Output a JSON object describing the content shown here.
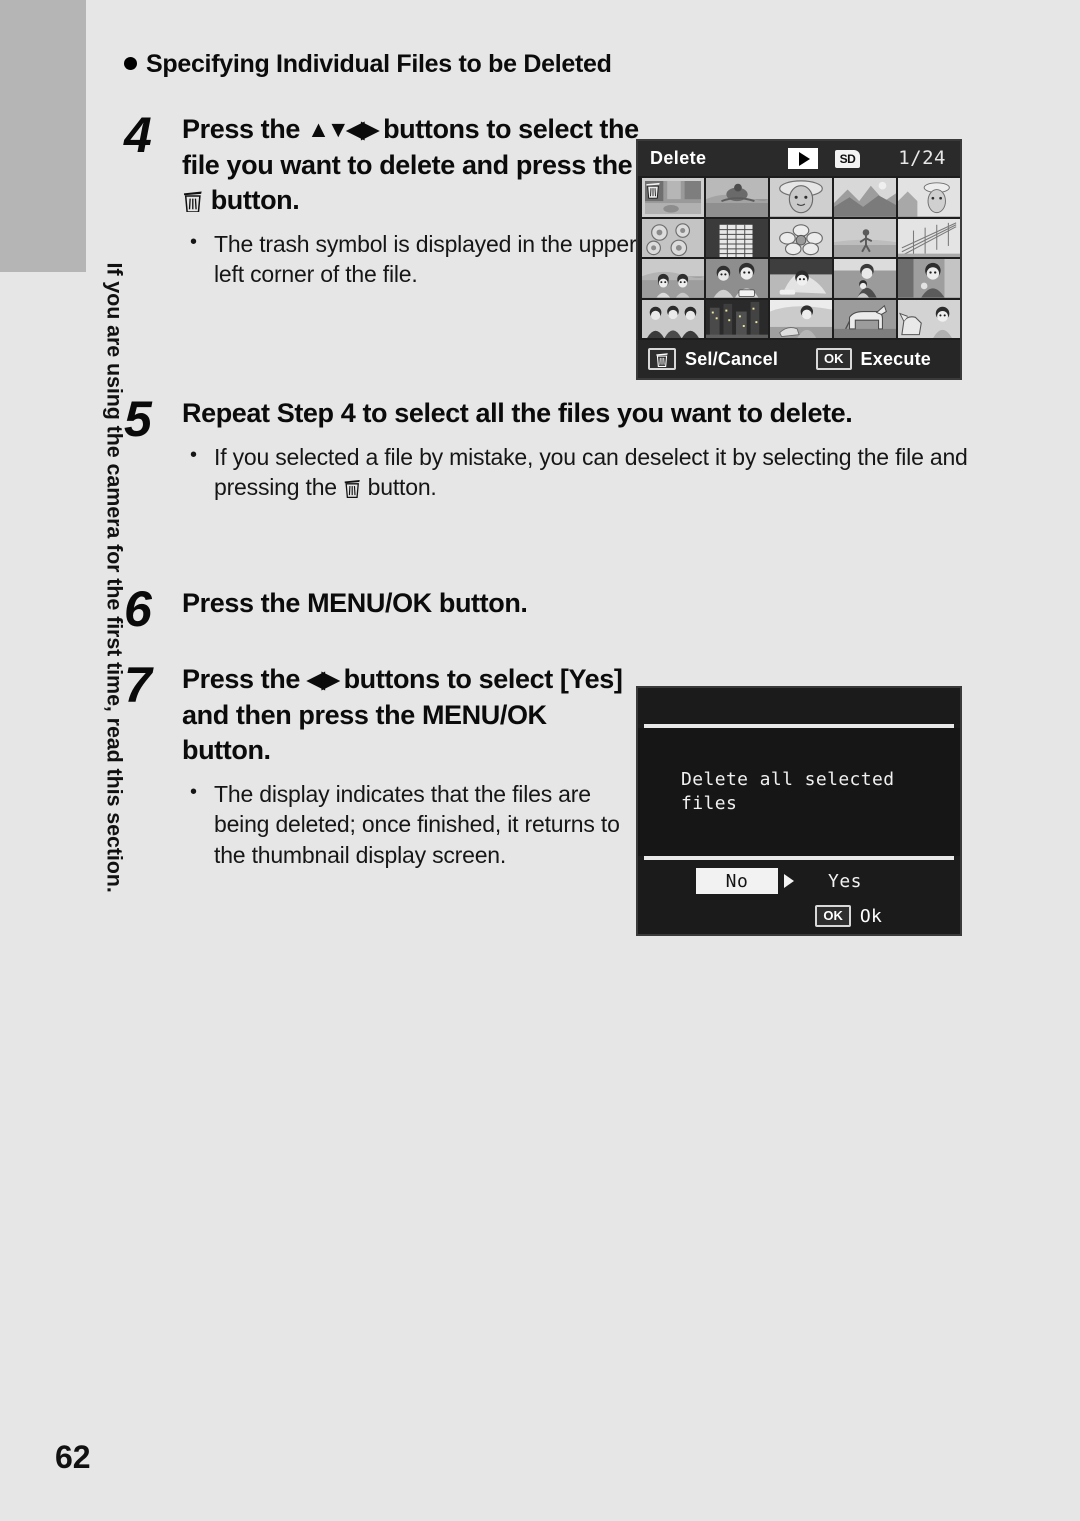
{
  "page": {
    "number": "62",
    "side_tab_label": "If you are using the camera for the first time, read this section."
  },
  "section": {
    "heading": "Specifying Individual Files to be Deleted"
  },
  "steps": [
    {
      "number": "4",
      "title_part1": "Press the ",
      "title_glyphs": "▲▼◀▶",
      "title_part2": " buttons to select the file you want to delete and press the ",
      "title_part3": " button.",
      "bullets": [
        "The trash symbol is displayed in the upper left corner of the file."
      ]
    },
    {
      "number": "5",
      "title": "Repeat Step 4 to select all the files you want to delete.",
      "bullet_part1": "If you selected a file by mistake, you can deselect it by selecting the file and pressing the ",
      "bullet_part2": " button."
    },
    {
      "number": "6",
      "title": "Press the MENU/OK button."
    },
    {
      "number": "7",
      "title_part1": "Press the ",
      "title_glyphs": "◀▶",
      "title_part2": " buttons to select [Yes] and then press the MENU/OK button.",
      "bullets": [
        "The display indicates that the files are being deleted; once finished, it returns to the thumbnail display screen."
      ]
    }
  ],
  "delete_screen": {
    "title": "Delete",
    "play_mode_icon": "play-icon",
    "storage_icon_label": "SD",
    "frame_counter": "1/24",
    "footer": {
      "sel_cancel_label": "Sel/Cancel",
      "ok_key_label": "OK",
      "execute_label": "Execute"
    },
    "thumbnails": [
      {
        "index": 1,
        "selected": true,
        "scene": "indoor-room"
      },
      {
        "index": 2,
        "selected": false,
        "scene": "person-surfing"
      },
      {
        "index": 3,
        "selected": false,
        "scene": "woman-hat-portrait"
      },
      {
        "index": 4,
        "selected": false,
        "scene": "mountain-landscape"
      },
      {
        "index": 5,
        "selected": false,
        "scene": "woman-building"
      },
      {
        "index": 6,
        "selected": false,
        "scene": "sunflowers"
      },
      {
        "index": 7,
        "selected": false,
        "scene": "tall-building"
      },
      {
        "index": 8,
        "selected": false,
        "scene": "flower-closeup"
      },
      {
        "index": 9,
        "selected": false,
        "scene": "person-beach"
      },
      {
        "index": 10,
        "selected": false,
        "scene": "bridge-structure"
      },
      {
        "index": 11,
        "selected": false,
        "scene": "two-children"
      },
      {
        "index": 12,
        "selected": false,
        "scene": "two-people-cake"
      },
      {
        "index": 13,
        "selected": false,
        "scene": "woman-lying"
      },
      {
        "index": 14,
        "selected": false,
        "scene": "mother-child"
      },
      {
        "index": 15,
        "selected": false,
        "scene": "woman-indoor"
      },
      {
        "index": 16,
        "selected": false,
        "scene": "group-photo"
      },
      {
        "index": 17,
        "selected": false,
        "scene": "night-city"
      },
      {
        "index": 18,
        "selected": false,
        "scene": "man-with-dog"
      },
      {
        "index": 19,
        "selected": false,
        "scene": "dog-standing"
      },
      {
        "index": 20,
        "selected": false,
        "scene": "child-with-dog"
      }
    ]
  },
  "confirm_screen": {
    "message": "Delete all selected\nfiles",
    "alert_icon": "exclamation-icon",
    "choice_no": "No",
    "choice_yes": "Yes",
    "selected_choice": "No",
    "ok_key_label": "OK",
    "ok_label": "Ok"
  },
  "colors": {
    "page_background": "#e6e6e6",
    "chapter_tab": "#b5b5b5",
    "screen_background": "#1d1d1d",
    "highlight": "#f2f2f2"
  }
}
